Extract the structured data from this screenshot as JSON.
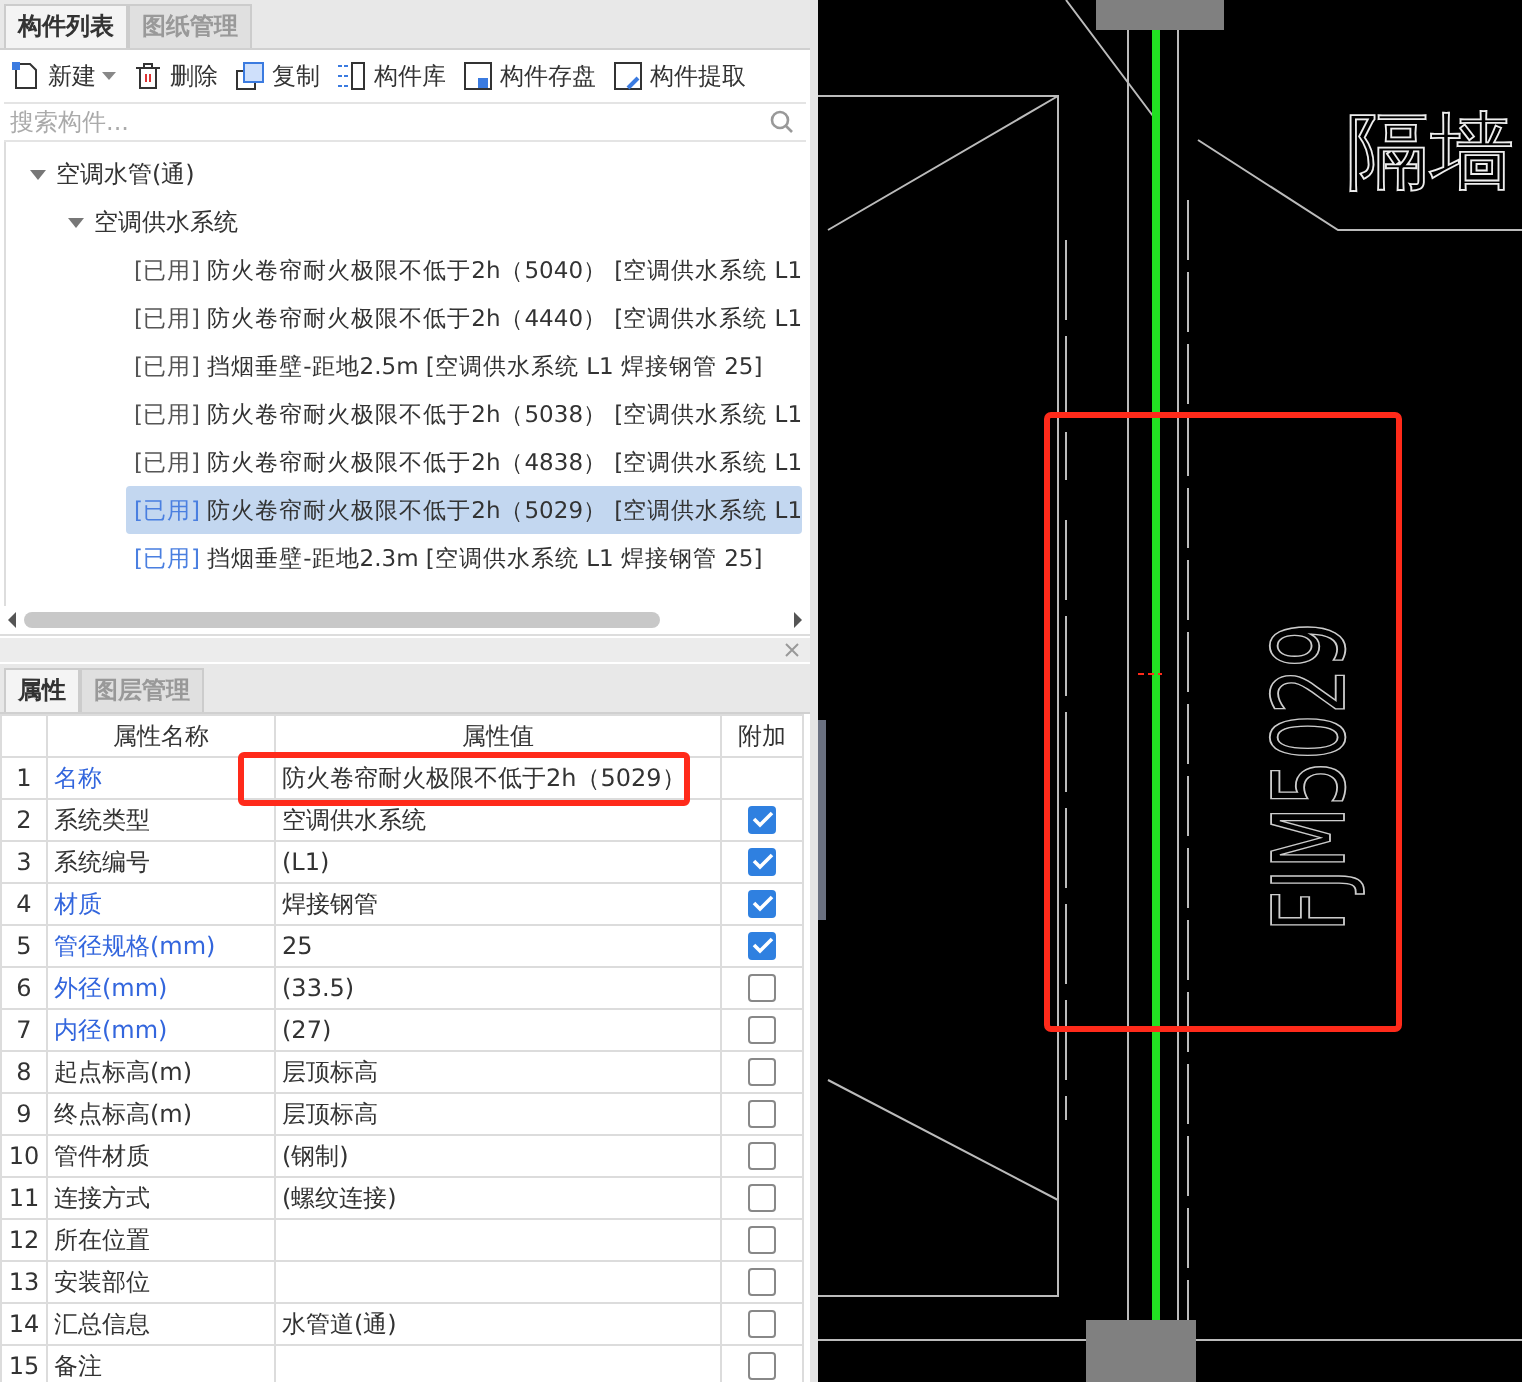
{
  "component_tabs": [
    {
      "label": "构件列表",
      "selected": true
    },
    {
      "label": "图纸管理",
      "selected": false
    }
  ],
  "toolbar": [
    {
      "kind": "new",
      "label": "新建",
      "dropdown": true
    },
    {
      "kind": "delete",
      "label": "删除",
      "dropdown": false
    },
    {
      "kind": "copy",
      "label": "复制",
      "dropdown": false
    },
    {
      "kind": "library",
      "label": "构件库",
      "dropdown": false
    },
    {
      "kind": "save",
      "label": "构件存盘",
      "dropdown": false
    },
    {
      "kind": "extract",
      "label": "构件提取",
      "dropdown": false
    }
  ],
  "search": {
    "placeholder": "搜索构件..."
  },
  "tree": [
    {
      "label": "空调水管(通)",
      "expanded": true,
      "children": [
        {
          "label": "空调供水系统",
          "expanded": true,
          "children": [
            {
              "tag": "[已用]",
              "color": "#555555",
              "label": "防火卷帘耐火极限不低于2h（5040） [空调供水系统 L1",
              "selected": false
            },
            {
              "tag": "[已用]",
              "color": "#555555",
              "label": "防火卷帘耐火极限不低于2h（4440） [空调供水系统 L1",
              "selected": false
            },
            {
              "tag": "[已用]",
              "color": "#555555",
              "label": "挡烟垂壁-距地2.5m [空调供水系统 L1 焊接钢管 25]",
              "selected": false
            },
            {
              "tag": "[已用]",
              "color": "#555555",
              "label": "防火卷帘耐火极限不低于2h（5038） [空调供水系统 L1",
              "selected": false
            },
            {
              "tag": "[已用]",
              "color": "#555555",
              "label": "防火卷帘耐火极限不低于2h（4838） [空调供水系统 L1",
              "selected": false
            },
            {
              "tag": "[已用]",
              "color": "#4a7fe0",
              "label": "防火卷帘耐火极限不低于2h（5029） [空调供水系统 L1",
              "selected": true
            },
            {
              "tag": "[已用]",
              "color": "#4a7fe0",
              "label": "挡烟垂壁-距地2.3m [空调供水系统 L1 焊接钢管 25]",
              "selected": false
            }
          ]
        }
      ]
    }
  ],
  "property_tabs": [
    {
      "label": "属性",
      "selected": true
    },
    {
      "label": "图层管理",
      "selected": false
    }
  ],
  "table": {
    "columns": [
      "属性名称",
      "属性值",
      "附加"
    ],
    "rows": [
      {
        "index": "1",
        "name": "名称",
        "value": "防火卷帘耐火极限不低于2h（5029）",
        "public": true,
        "kind": "plain"
      },
      {
        "index": "2",
        "name": "系统类型",
        "value": "空调供水系统",
        "public": false,
        "kind": "check",
        "checked": true
      },
      {
        "index": "3",
        "name": "系统编号",
        "value": "(L1)",
        "public": false,
        "kind": "check",
        "checked": true
      },
      {
        "index": "4",
        "name": "材质",
        "value": "焊接钢管",
        "public": true,
        "kind": "check",
        "checked": true
      },
      {
        "index": "5",
        "name": "管径规格(mm)",
        "value": "25",
        "public": true,
        "kind": "check",
        "checked": true
      },
      {
        "index": "6",
        "name": "外径(mm)",
        "value": "(33.5)",
        "public": true,
        "kind": "check",
        "checked": false
      },
      {
        "index": "7",
        "name": "内径(mm)",
        "value": "(27)",
        "public": true,
        "kind": "check",
        "checked": false
      },
      {
        "index": "8",
        "name": "起点标高(m)",
        "value": "层顶标高",
        "public": false,
        "kind": "check",
        "checked": false
      },
      {
        "index": "9",
        "name": "终点标高(m)",
        "value": "层顶标高",
        "public": false,
        "kind": "check",
        "checked": false
      },
      {
        "index": "10",
        "name": "管件材质",
        "value": "(钢制)",
        "public": false,
        "kind": "check",
        "checked": false
      },
      {
        "index": "11",
        "name": "连接方式",
        "value": "(螺纹连接)",
        "public": false,
        "kind": "check",
        "checked": false
      },
      {
        "index": "12",
        "name": "所在位置",
        "value": "",
        "public": false,
        "kind": "check",
        "checked": false
      },
      {
        "index": "13",
        "name": "安装部位",
        "value": "",
        "public": false,
        "kind": "check",
        "checked": false
      },
      {
        "index": "14",
        "name": "汇总信息",
        "value": "水管道(通)",
        "public": false,
        "kind": "check",
        "checked": false
      },
      {
        "index": "15",
        "name": "备注",
        "value": "",
        "public": false,
        "kind": "check",
        "checked": false
      }
    ]
  },
  "canvas": {
    "wall_label": "隔墙",
    "door_label": "FJM5029"
  }
}
